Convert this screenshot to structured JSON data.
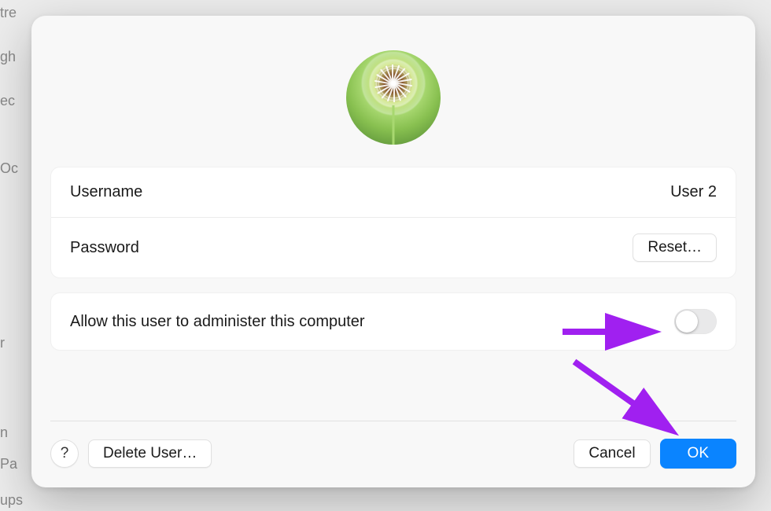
{
  "background": {
    "fragments": [
      "tre",
      "gh",
      "ec",
      "Oc",
      "r",
      "n",
      "Pa",
      "ups"
    ]
  },
  "dialog": {
    "avatar_alt": "dandelion-icon",
    "rows": {
      "username": {
        "label": "Username",
        "value": "User 2"
      },
      "password": {
        "label": "Password",
        "button": "Reset…"
      }
    },
    "admin": {
      "label": "Allow this user to administer this computer",
      "enabled": false
    }
  },
  "footer": {
    "help": "?",
    "delete": "Delete User…",
    "cancel": "Cancel",
    "ok": "OK"
  },
  "annotations": {
    "arrow1": {
      "target": "admin-toggle",
      "color": "#a020f0"
    },
    "arrow2": {
      "target": "ok-button",
      "color": "#a020f0"
    }
  }
}
